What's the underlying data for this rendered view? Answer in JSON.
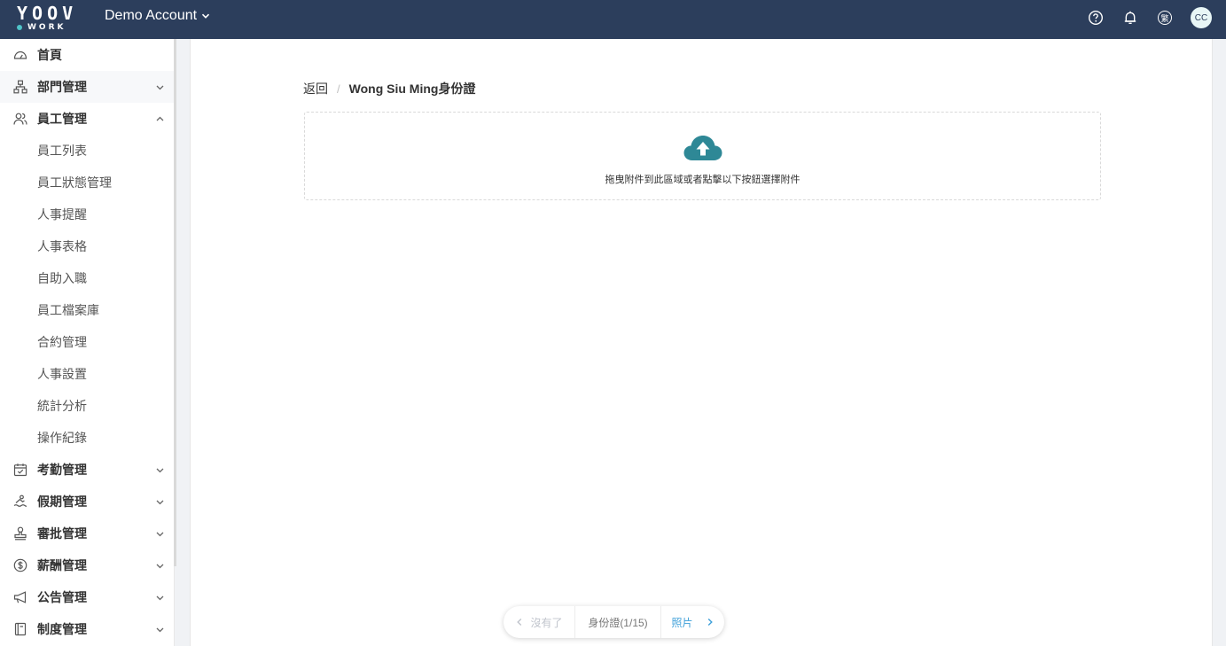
{
  "header": {
    "logo_top": "YOOV",
    "logo_bottom": "WORK",
    "account": "Demo Account",
    "lang": "繁",
    "avatar": "CC"
  },
  "sidebar": {
    "home": "首頁",
    "dept": "部門管理",
    "staff": "員工管理",
    "staff_sub": [
      "員工列表",
      "員工狀態管理",
      "人事提醒",
      "人事表格",
      "自助入職",
      "員工檔案庫",
      "合約管理",
      "人事設置",
      "統計分析",
      "操作紀錄"
    ],
    "attendance": "考勤管理",
    "leave": "假期管理",
    "approval": "審批管理",
    "payroll": "薪酬管理",
    "notice": "公告管理",
    "policy": "制度管理"
  },
  "breadcrumb": {
    "back": "返回",
    "separator": "/",
    "current": "Wong Siu Ming身份證"
  },
  "dropzone": {
    "hint": "拖曳附件到此區域或者點擊以下按鈕選擇附件"
  },
  "pager": {
    "prev": "沒有了",
    "current": "身份證(1/15)",
    "next": "照片"
  },
  "colors": {
    "topbar": "#2c3e5c",
    "accent": "#2e8896",
    "link": "#3d9fd9"
  }
}
